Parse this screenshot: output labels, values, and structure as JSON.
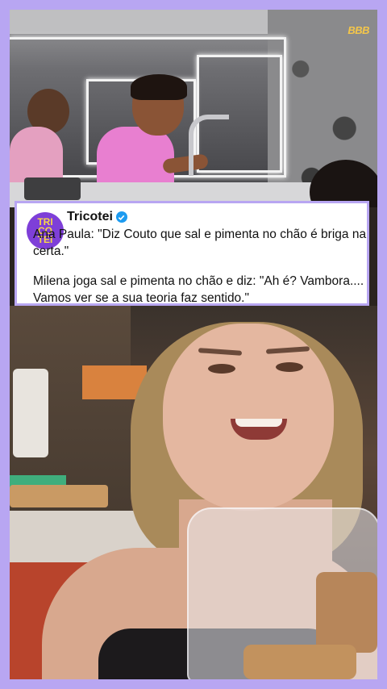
{
  "watermark": {
    "text": "BBB"
  },
  "tweet": {
    "handle": "Tricotei",
    "avatar_lines": [
      "TRI",
      "CO",
      "TEI"
    ],
    "paragraph_1": "Ana Paula: \"Diz Couto que sal e pimenta no chão é briga na certa.\"",
    "paragraph_2": "Milena joga sal e pimenta no chão e diz: \"Ah é? Vambora.... Vamos ver se a sua teoria faz sentido.\""
  },
  "colors": {
    "frame_border": "#b8a6f2",
    "avatar_bg": "#7e3fd8",
    "avatar_text": "#f7d64a",
    "verified": "#1d9bf0",
    "top_shirt": "#e87fd0"
  },
  "icons": {
    "verified": "verified-badge-icon"
  }
}
